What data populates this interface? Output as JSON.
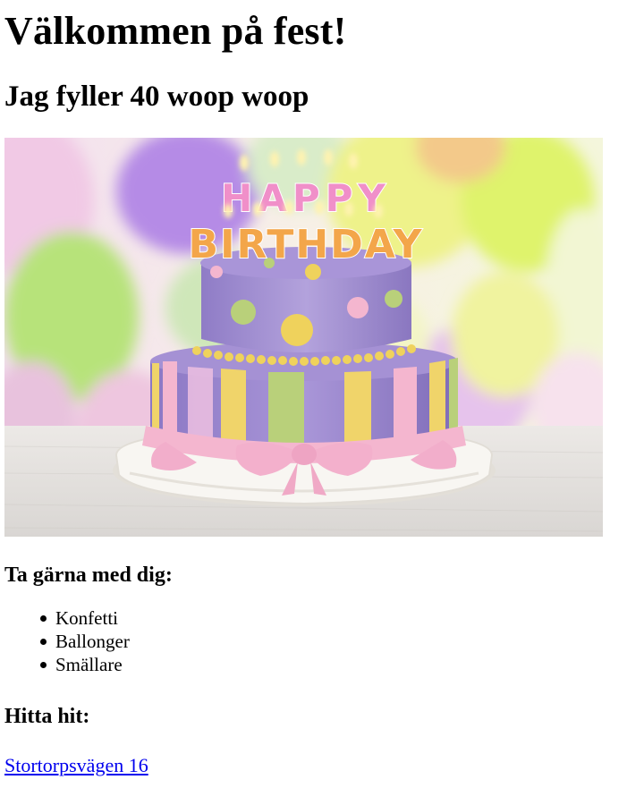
{
  "title": "Välkommen på fest!",
  "subtitle": "Jag fyller 40 woop woop",
  "image": {
    "icon": "birthday-cake-image",
    "topper_line1": "HAPPY",
    "topper_line2": "BIRTHDAY",
    "colors": {
      "cake_top": "#a692d2",
      "cake_bottom": "#9a86cf",
      "ribbon_pink": "#f4b6cf",
      "stripe_yellow": "#f0d46a",
      "stripe_green": "#b9d07a",
      "plate": "#f6f3ee"
    }
  },
  "bring": {
    "heading": "Ta gärna med dig:",
    "items": [
      "Konfetti",
      "Ballonger",
      "Smällare"
    ]
  },
  "directions": {
    "heading": "Hitta hit:",
    "link_text": "Stortorpsvägen 16"
  }
}
